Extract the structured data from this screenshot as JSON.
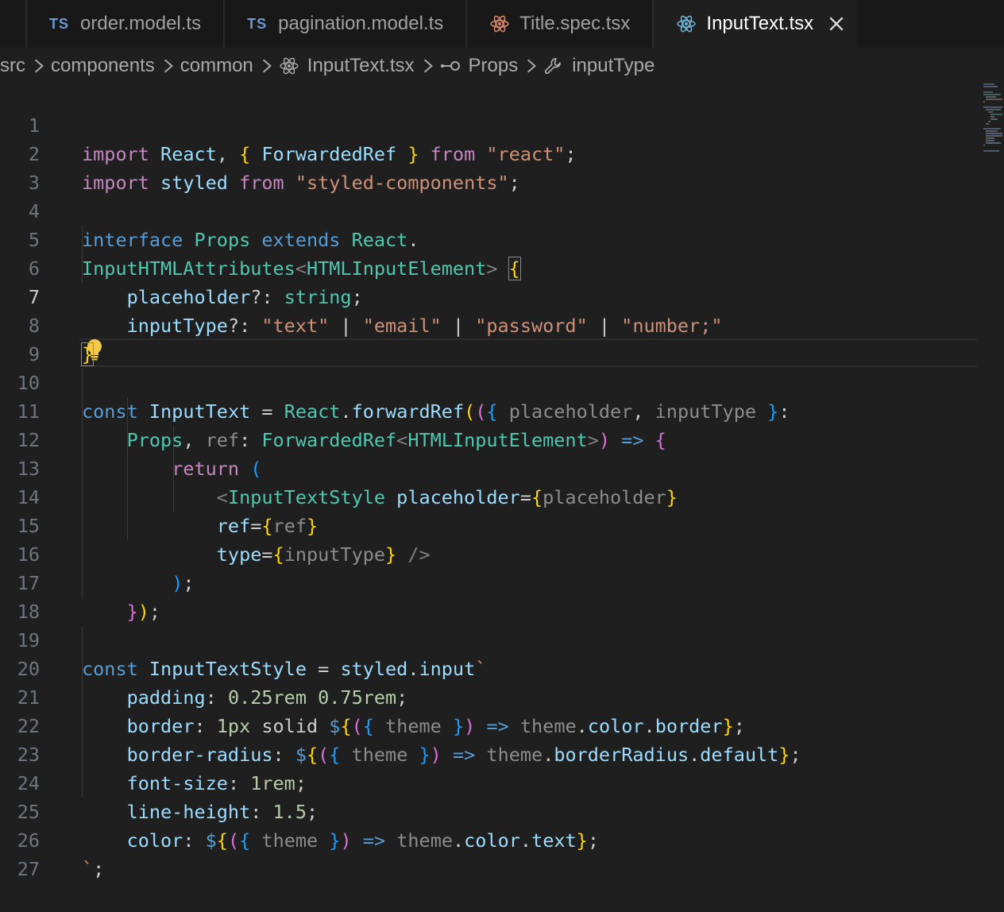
{
  "tabs": [
    {
      "badge": "TS",
      "label": "order.model.ts",
      "icon": "typescript-icon"
    },
    {
      "badge": "TS",
      "label": "pagination.model.ts",
      "icon": "typescript-icon"
    },
    {
      "badge": "",
      "label": "Title.spec.tsx",
      "icon": "react-icon"
    },
    {
      "badge": "",
      "label": "InputText.tsx",
      "icon": "react-icon",
      "active": true
    }
  ],
  "breadcrumb": {
    "items": [
      "src",
      "components",
      "common",
      "InputText.tsx",
      "Props",
      "inputType"
    ]
  },
  "lines": [
    {
      "n": "1",
      "code": "import React, { ForwardedRef } from \"react\";"
    },
    {
      "n": "2",
      "code": "import styled from \"styled-components\";"
    },
    {
      "n": "3",
      "code": ""
    },
    {
      "n": "4",
      "code": "interface Props extends React."
    },
    {
      "n": "5",
      "code": "InputHTMLAttributes<HTMLInputElement> {"
    },
    {
      "n": "6",
      "code": "    placeholder?: string;"
    },
    {
      "n": "7",
      "code": "    inputType?: \"text\" | \"email\" | \"password\" | \"number;\""
    },
    {
      "n": "8",
      "code": "}"
    },
    {
      "n": "9",
      "code": ""
    },
    {
      "n": "10",
      "code": "const InputText = React.forwardRef(({ placeholder, inputType }:"
    },
    {
      "n": "11",
      "code": "    Props, ref: ForwardedRef<HTMLInputElement>) => {"
    },
    {
      "n": "12",
      "code": "        return ("
    },
    {
      "n": "13",
      "code": "            <InputTextStyle placeholder={placeholder}"
    },
    {
      "n": "14",
      "code": "            ref={ref}"
    },
    {
      "n": "15",
      "code": "            type={inputType} />"
    },
    {
      "n": "16",
      "code": "        );"
    },
    {
      "n": "17",
      "code": "    });"
    },
    {
      "n": "18",
      "code": ""
    },
    {
      "n": "19",
      "code": "const InputTextStyle = styled.input`"
    },
    {
      "n": "20",
      "code": "    padding: 0.25rem 0.75rem;"
    },
    {
      "n": "21",
      "code": "    border: 1px solid ${({ theme }) => theme.color.border};"
    },
    {
      "n": "22",
      "code": "    border-radius: ${({ theme }) => theme.borderRadius.default};"
    },
    {
      "n": "23",
      "code": "    font-size: 1rem;"
    },
    {
      "n": "24",
      "code": "    line-height: 1.5;"
    },
    {
      "n": "25",
      "code": "    color: ${({ theme }) => theme.color.text};"
    },
    {
      "n": "26",
      "code": "`;"
    },
    {
      "n": "27",
      "code": ""
    }
  ],
  "cursor_line": "7",
  "colors": {
    "background": "#1f1f1f",
    "tabbar": "#181818",
    "active_tab_text": "#ffffff"
  }
}
